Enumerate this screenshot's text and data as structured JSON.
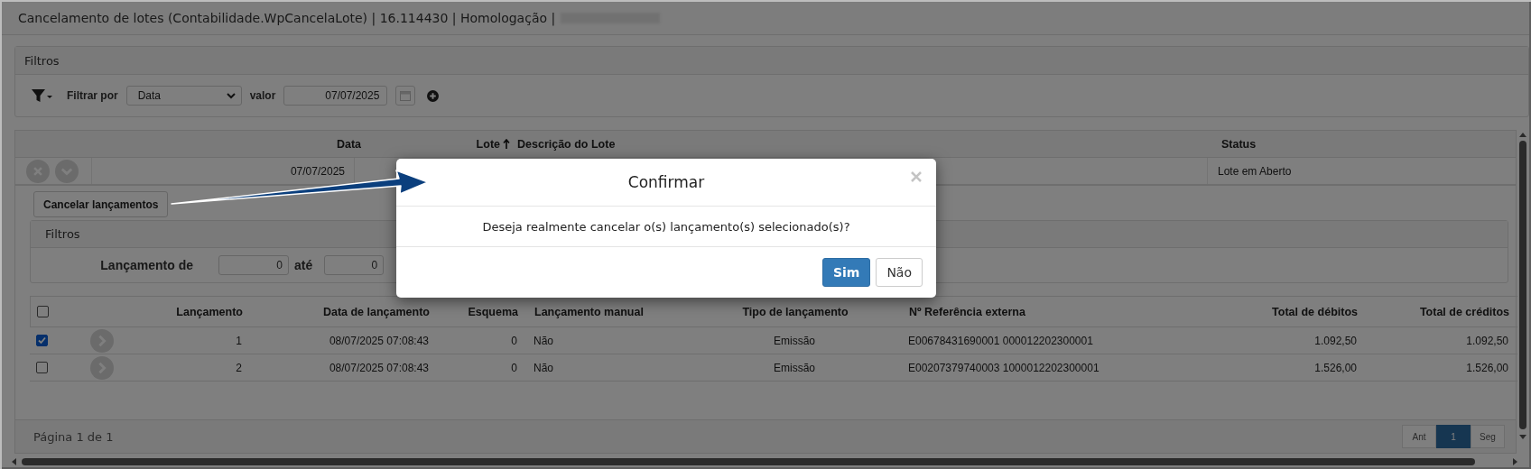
{
  "window": {
    "title": "Cancelamento de lotes (Contabilidade.WpCancelaLote) | 16.114430 | Homologação |"
  },
  "filters": {
    "title": "Filtros",
    "filter_label": "Filtrar por",
    "field": "Data",
    "value_label": "valor",
    "value": "07/07/2025"
  },
  "lots_table": {
    "columns": [
      {
        "label": "Data",
        "sorted": false
      },
      {
        "label": "Lote",
        "sorted": true
      },
      {
        "label": "Descrição do Lote",
        "sorted": false
      },
      {
        "label": "Status",
        "sorted": false
      }
    ],
    "rows": [
      {
        "data": "07/07/2025",
        "status": "Lote em Aberto",
        "expanded": true
      }
    ]
  },
  "detail": {
    "cancel_button": "Cancelar lançamentos",
    "filters": {
      "title": "Filtros",
      "from_label": "Lançamento de",
      "from_value": "0",
      "to_label": "até",
      "to_value": "0"
    },
    "table": {
      "select_all_checked": false,
      "columns": [
        "Lançamento",
        "Data de lançamento",
        "Esquema",
        "Lançamento manual",
        "Tipo de lançamento",
        "Nº Referência externa",
        "Total de débitos",
        "Total de créditos"
      ],
      "rows": [
        {
          "checked": true,
          "cells": [
            "1",
            "08/07/2025 07:08:43",
            "0",
            "Não",
            "Emissão",
            "E00678431690001 000012202300001",
            "1.092,50",
            "1.092,50"
          ]
        },
        {
          "checked": false,
          "cells": [
            "2",
            "08/07/2025 07:08:43",
            "0",
            "Não",
            "Emissão",
            "E00207379740003 1000012202300001",
            "1.526,00",
            "1.526,00"
          ]
        }
      ]
    },
    "footer": {
      "page_info": "Página 1 de 1",
      "pagination": [
        {
          "label": "Ant",
          "selected": false
        },
        {
          "label": "1",
          "selected": true
        },
        {
          "label": "Seg",
          "selected": false
        }
      ]
    }
  },
  "dialog": {
    "title": "Confirmar",
    "message": "Deseja realmente cancelar o(s) lançamento(s) selecionado(s)?",
    "buttons": [
      {
        "label": "Sim",
        "kind": "primary"
      },
      {
        "label": "Não",
        "kind": "default"
      }
    ]
  }
}
